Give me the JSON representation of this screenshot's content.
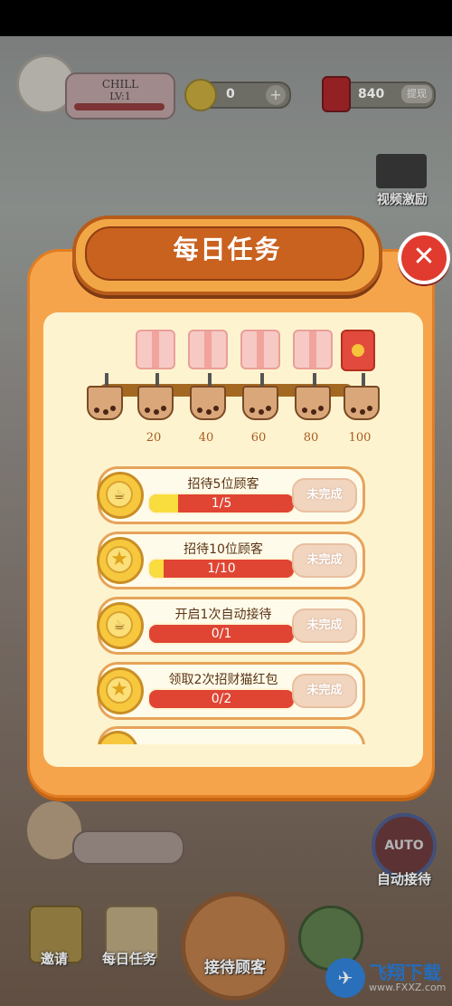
{
  "hud": {
    "player_name": "CHILL",
    "player_level": "LV:1",
    "coins": "0",
    "coins_plus": "+",
    "red_envelope_value": "840",
    "withdraw_label": "提现",
    "video_reward_label": "视频激励"
  },
  "modal": {
    "title": "每日任务",
    "close_label": "✕",
    "milestones": [
      "20",
      "40",
      "60",
      "80",
      "100"
    ],
    "tasks": [
      {
        "name": "招待5位顾客",
        "progress": "1/5",
        "fraction": 0.2,
        "button": "未完成",
        "icon": "coin-icon"
      },
      {
        "name": "招待10位顾客",
        "progress": "1/10",
        "fraction": 0.1,
        "button": "未完成",
        "icon": "star-icon"
      },
      {
        "name": "开启1次自动接待",
        "progress": "0/1",
        "fraction": 0,
        "button": "未完成",
        "icon": "coin-icon"
      },
      {
        "name": "领取2次招财猫红包",
        "progress": "0/2",
        "fraction": 0,
        "button": "未完成",
        "icon": "star-icon"
      }
    ]
  },
  "bottom": {
    "auto_label": "AUTO",
    "auto_receive_label": "自动接待",
    "nav": {
      "invite": "邀请",
      "daily_tasks": "每日任务",
      "serve_customers": "接待顾客"
    },
    "watermark_title": "飞翔下载",
    "watermark_url": "www.FXXZ.com"
  }
}
